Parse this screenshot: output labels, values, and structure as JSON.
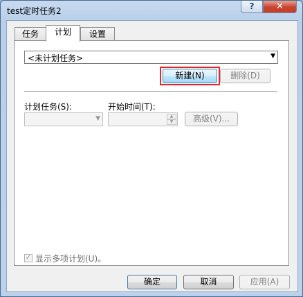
{
  "window": {
    "title": "test定时任务2",
    "help_label": "?",
    "close_label": "✕"
  },
  "tabs": [
    {
      "label": "任务"
    },
    {
      "label": "计划"
    },
    {
      "label": "设置"
    }
  ],
  "schedule": {
    "schedule_select_value": "<未计划任务>",
    "new_label": "新建(N)",
    "delete_label": "删除(D)",
    "schedule_task_label": "计划任务(S):",
    "start_time_label": "开始时间(T):",
    "advanced_label": "高级(V)...",
    "show_multiple_label": "显示多项计划(U)。"
  },
  "footer": {
    "ok_label": "确定",
    "cancel_label": "取消",
    "apply_label": "应用(A)"
  },
  "icons": {
    "dropdown": "chevron-down-icon",
    "spin_up": "spin-up-icon",
    "spin_down": "spin-down-icon",
    "check": "checkmark-icon"
  }
}
